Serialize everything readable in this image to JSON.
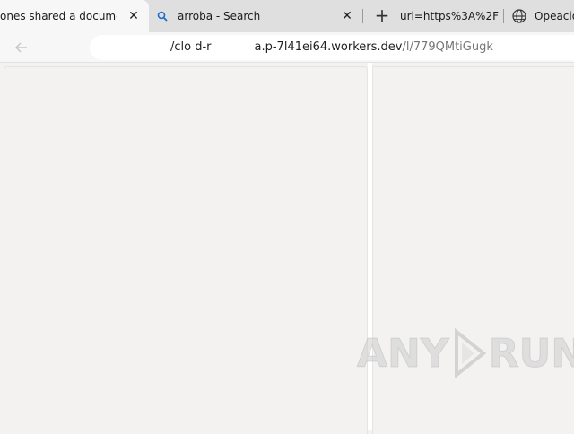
{
  "tabs": [
    {
      "title": "ones shared a document w",
      "close": "✕"
    },
    {
      "title": "arroba - Search",
      "close": "✕"
    },
    {
      "title": "url=https%3A%2F",
      "icon": "new-tab-icon"
    },
    {
      "title": "Opeacio"
    }
  ],
  "toolbar": {
    "back_icon": "back-arrow-icon",
    "url_host_fragment": "/clo d-r",
    "url_host_main": "a.p-7l41ei64.workers.dev",
    "url_path": "/l/779QMtiGugk"
  },
  "watermark": {
    "left": "ANY",
    "right": "RUN"
  },
  "colors": {
    "tabstrip": "#dfdfdf",
    "active_tab": "#f7f7f7",
    "content": "#f3f2f1",
    "search_icon": "#1a6fd0"
  }
}
